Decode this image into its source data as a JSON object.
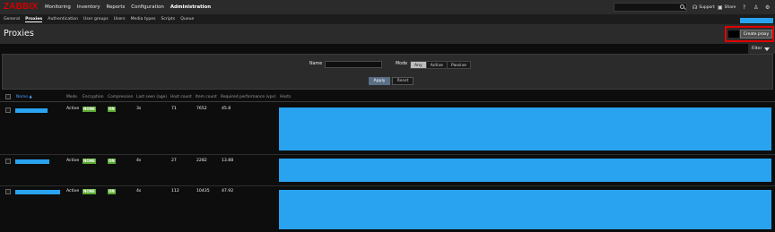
{
  "app": {
    "logo": "ZABBIX",
    "menu": [
      "Monitoring",
      "Inventory",
      "Reports",
      "Configuration",
      "Administration"
    ],
    "tools": {
      "support": "Support",
      "share": "Share",
      "help": "?"
    }
  },
  "subnav": {
    "items": [
      "General",
      "Proxies",
      "Authentication",
      "User groups",
      "Users",
      "Media types",
      "Scripts",
      "Queue"
    ]
  },
  "page": {
    "title": "Proxies",
    "create_button": "Create proxy"
  },
  "filter": {
    "tab_label": "Filter",
    "name_label": "Name",
    "name_value": "",
    "mode_label": "Mode",
    "mode_options": [
      "Any",
      "Active",
      "Passive"
    ],
    "mode_selected": "Any",
    "apply": "Apply",
    "reset": "Reset"
  },
  "table": {
    "headers": [
      "Name",
      "Mode",
      "Encryption",
      "Compression",
      "Last seen (age)",
      "Host count",
      "Item count",
      "Required performance (vps)",
      "Hosts"
    ],
    "sort_arrow": "▲",
    "rows": [
      {
        "mode": "Active",
        "encryption": "NONE",
        "compression": "ON",
        "last_seen": "3s",
        "host_count": "71",
        "item_count": "7652",
        "performance": "45.8"
      },
      {
        "mode": "Active",
        "encryption": "NONE",
        "compression": "ON",
        "last_seen": "4s",
        "host_count": "27",
        "item_count": "2282",
        "performance": "13.88"
      },
      {
        "mode": "Active",
        "encryption": "NONE",
        "compression": "ON",
        "last_seen": "4s",
        "host_count": "112",
        "item_count": "10435",
        "performance": "47.92"
      }
    ]
  },
  "colors": {
    "accent": "#29a3f0",
    "badge_green": "#59a830",
    "highlight": "#e00000",
    "logo": "#d40000"
  }
}
